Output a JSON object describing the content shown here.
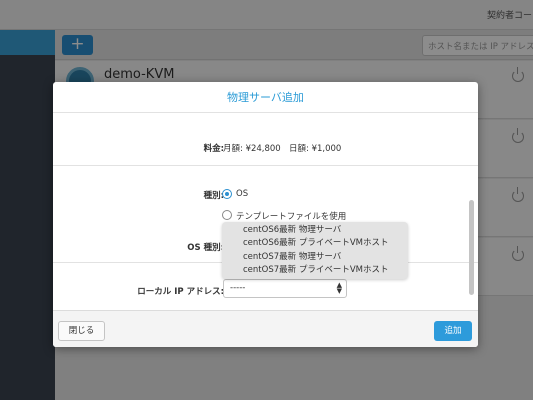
{
  "header": {
    "contract_label": "契約者コード"
  },
  "toolbar": {
    "add_label": "+",
    "search_placeholder": "ホスト名または IP アドレス"
  },
  "servers": [
    {
      "name": "demo-KVM"
    }
  ],
  "modal": {
    "title": "物理サーバ追加",
    "fee": {
      "label": "料金:",
      "monthly": "月額: ¥24,800",
      "daily": "日額: ¥1,000"
    },
    "type": {
      "label": "種別:",
      "options": [
        {
          "label": "OS",
          "selected": true
        },
        {
          "label": "テンプレートファイルを使用",
          "selected": false
        }
      ]
    },
    "os_type": {
      "label": "OS 種別:",
      "dropdown_options": [
        "centOS6最新 物理サーバ",
        "centOS6最新 プライベートVMホスト",
        "centOS7最新 物理サーバ",
        "centOS7最新 プライベートVMホスト"
      ]
    },
    "local_ip": {
      "label": "ローカル IP アドレス:",
      "value": "-----"
    },
    "footer": {
      "close_label": "閉じる",
      "add_label": "追加"
    }
  },
  "colors": {
    "accent": "#2a9bd6",
    "sidebar": "#3b4450"
  }
}
